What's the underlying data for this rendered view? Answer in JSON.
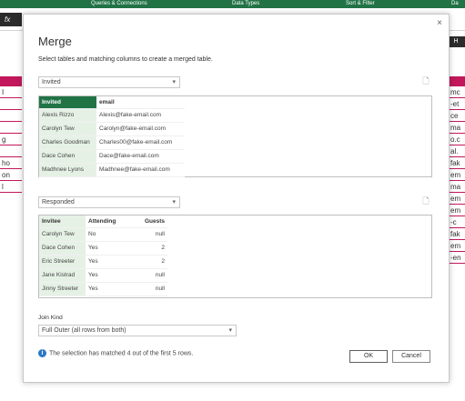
{
  "ribbon": {
    "groups": [
      "Queries & Connections",
      "Data Types",
      "Sort & Filter",
      "Da"
    ]
  },
  "namebox": "fx",
  "right_hint": "H",
  "left_column": [
    "I",
    "",
    "",
    "",
    "g",
    "",
    "ho",
    "on",
    "l"
  ],
  "right_column": [
    "mc",
    "-et",
    "ce",
    "ma",
    "o.c",
    "al.",
    "fak",
    "em",
    "ma",
    "em",
    "em",
    "-c",
    "fak",
    "em",
    "-en"
  ],
  "dialog": {
    "title": "Merge",
    "close_label": "×",
    "description": "Select tables and matching columns to create a merged table.",
    "first_table": {
      "selected": "Invited",
      "columns": [
        "Invited",
        "email"
      ],
      "rows": [
        [
          "Alexis Rizzo",
          "Alexis@fake-email.com"
        ],
        [
          "Carolyn Tew",
          "Carolyn@fake-email.com"
        ],
        [
          "Charles Goodman",
          "Charles00@fake-email.com"
        ],
        [
          "Dace Cohen",
          "Dace@fake-email.com"
        ],
        [
          "Madhnee Lyons",
          "Madhnee@fake-email.com"
        ]
      ]
    },
    "second_table": {
      "selected": "Responded",
      "columns": [
        "Invitee",
        "Attending",
        "Guests"
      ],
      "rows": [
        [
          "Carolyn Tew",
          "No",
          "null"
        ],
        [
          "Dace Cohen",
          "Yes",
          "2"
        ],
        [
          "Eric Streeter",
          "Yes",
          "2"
        ],
        [
          "Jane Kistrad",
          "Yes",
          "null"
        ],
        [
          "Jinny Streeter",
          "Yes",
          "null"
        ]
      ]
    },
    "join_kind": {
      "label": "Join Kind",
      "selected": "Full Outer (all rows from both)"
    },
    "info_text": "The selection has matched 4 out of the first 5 rows.",
    "ok_label": "OK",
    "cancel_label": "Cancel"
  },
  "colors": {
    "excel_green": "#217346",
    "table_stripe": "#c2185b",
    "key_column": "#e6f1e6",
    "info_blue": "#2b78c5"
  },
  "icons": [
    "close-icon",
    "chevron-down-icon",
    "file-icon",
    "info-icon"
  ]
}
